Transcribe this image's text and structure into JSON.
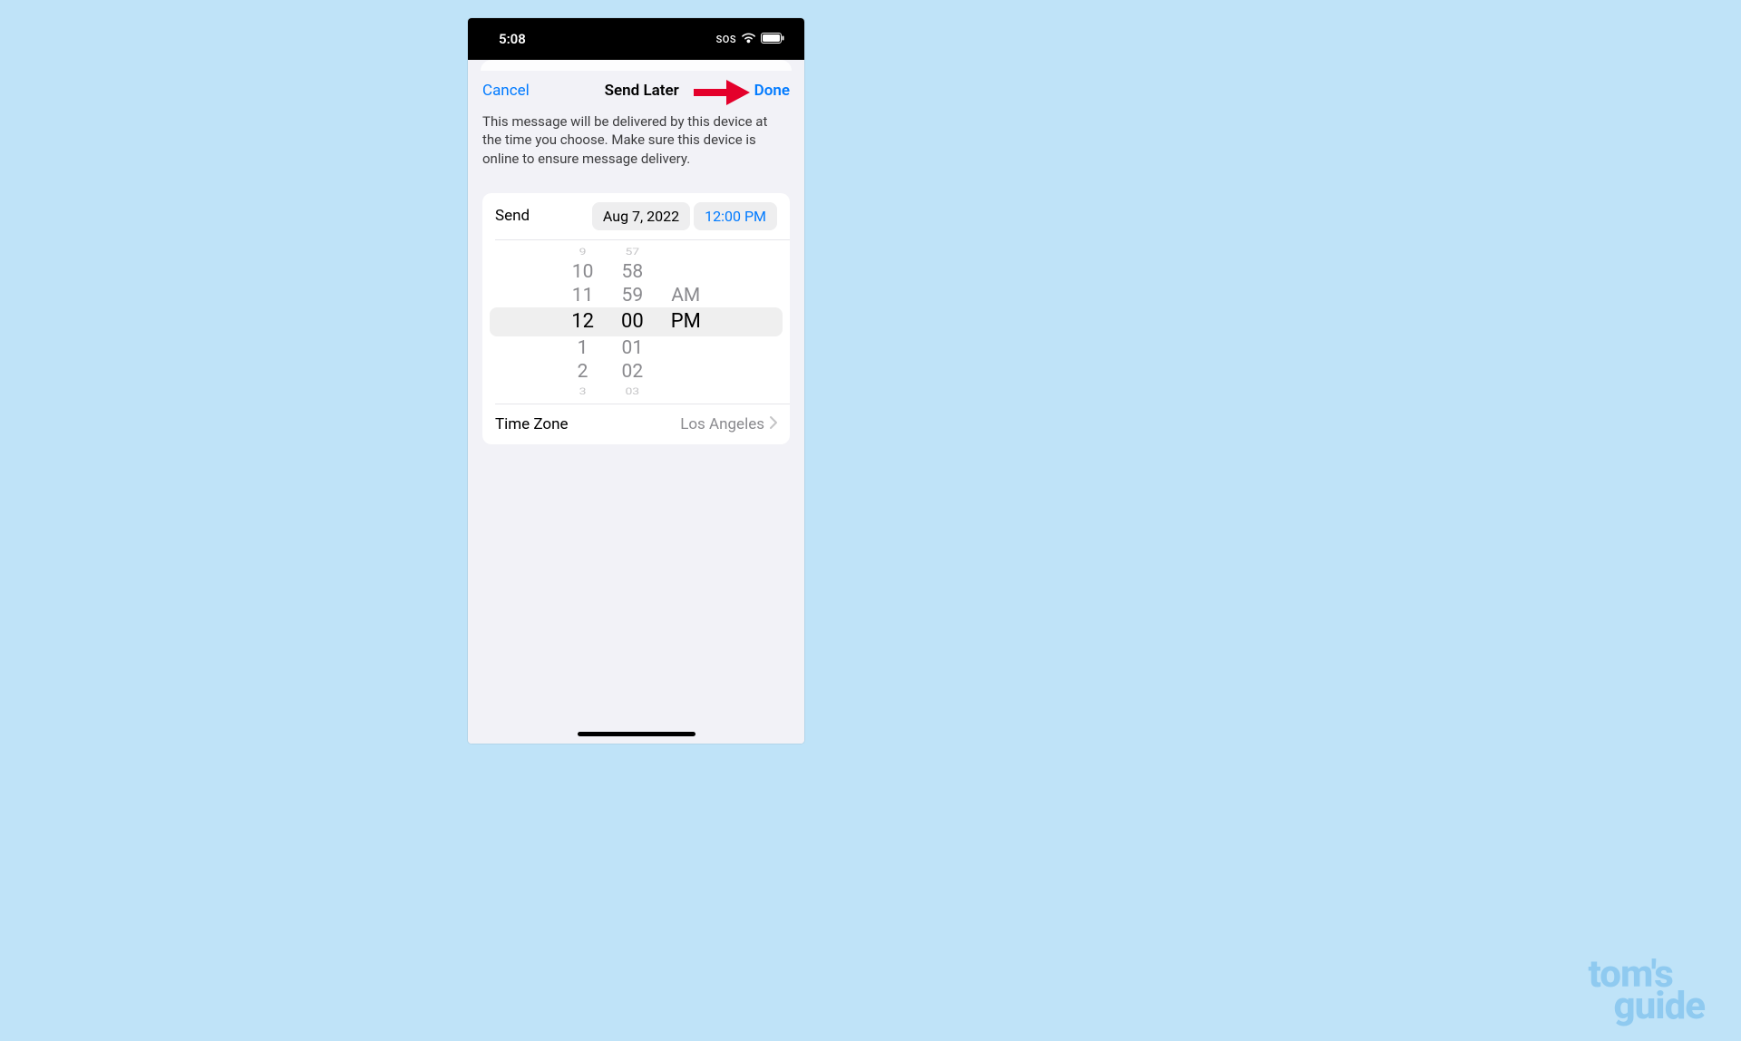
{
  "status": {
    "time": "5:08",
    "sos": "SOS"
  },
  "nav": {
    "cancel": "Cancel",
    "title": "Send Later",
    "done": "Done"
  },
  "description": "This message will be delivered by this device at the time you choose. Make sure this device is online to ensure message delivery.",
  "send": {
    "label": "Send",
    "date": "Aug 7, 2022",
    "time": "12:00 PM"
  },
  "picker": {
    "hours": [
      "9",
      "10",
      "11",
      "12",
      "1",
      "2",
      "3"
    ],
    "minutes": [
      "57",
      "58",
      "59",
      "00",
      "01",
      "02",
      "03"
    ],
    "ampm": [
      "AM",
      "PM"
    ]
  },
  "timezone": {
    "label": "Time Zone",
    "value": "Los Angeles"
  },
  "watermark": {
    "line1": "tom's",
    "line2": "guide"
  }
}
